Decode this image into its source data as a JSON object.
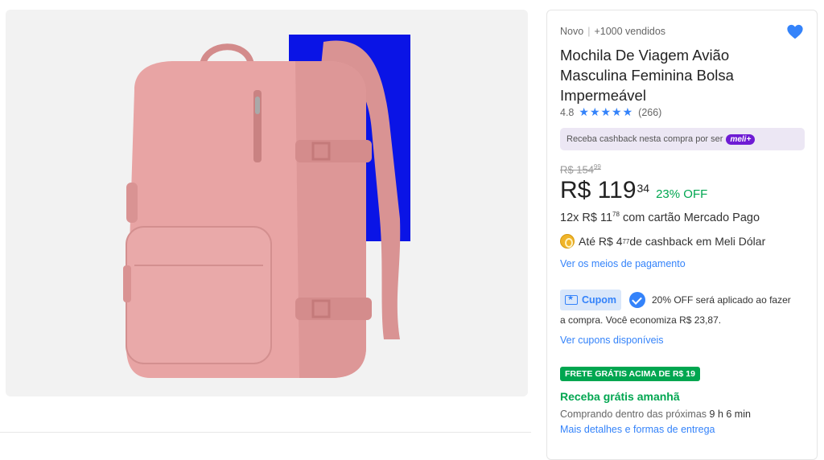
{
  "product": {
    "condition": "Novo",
    "sold": "+1000 vendidos",
    "title": "Mochila De Viagem Avião Masculina Feminina Bolsa Impermeável",
    "rating": "4.8",
    "reviews": "(266)",
    "stars": 5,
    "favorited": true
  },
  "cashback_banner": {
    "text": "Receba cashback nesta compra por ser",
    "badge": "meli+"
  },
  "price": {
    "old": "R$ 154",
    "old_cents": "99",
    "current": "R$ 119",
    "current_cents": "34",
    "discount": "23% OFF"
  },
  "installments": {
    "prefix": "12x R$ 11",
    "cents": "78",
    "suffix": " com cartão Mercado Pago"
  },
  "meli_dolar": {
    "prefix": "Até R$ 4",
    "cents": "77",
    "suffix": " de cashback em Meli Dólar"
  },
  "links": {
    "payment_methods": "Ver os meios de pagamento",
    "coupons": "Ver cupons disponíveis",
    "shipping_details": "Mais detalhes e formas de entrega"
  },
  "coupon": {
    "label": "Cupom",
    "text_line1": "20% OFF será aplicado ao fazer",
    "text_line2": "a compra. Você economiza R$ 23,87."
  },
  "shipping": {
    "badge": "FRETE GRÁTIS ACIMA DE R$ 19",
    "delivery": "Receba grátis amanhã",
    "countdown_prefix": "Comprando dentro das próximas ",
    "countdown_time": "9 h 6 min"
  },
  "colors": {
    "accent": "#3483fa",
    "success": "#00a650",
    "product_pink": "#e9a6a6",
    "background_block": "#0a14e6"
  }
}
